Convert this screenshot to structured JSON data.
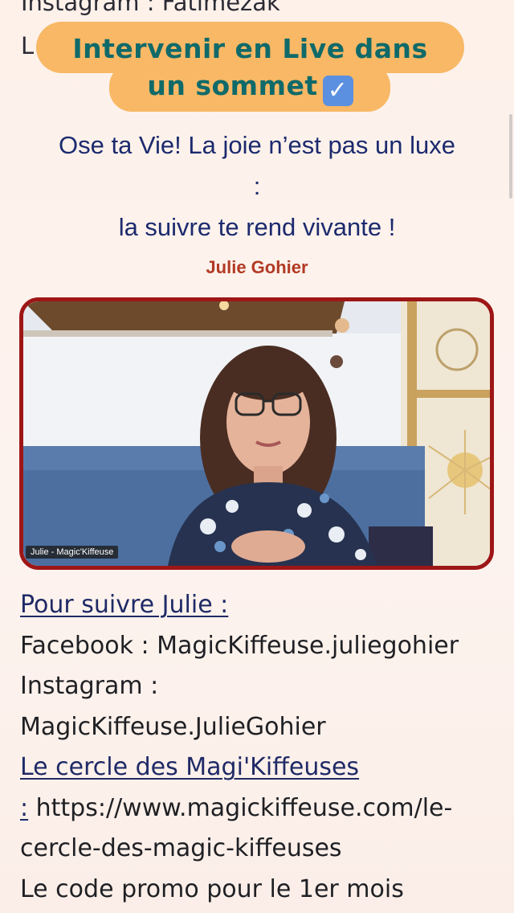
{
  "prev_section": {
    "instagram_line": "Instagram : Fatimezak",
    "cut_letter": "L"
  },
  "banner": {
    "line1": "Intervenir en Live dans",
    "line2": "un sommet",
    "check_icon": "check-mark-button-icon"
  },
  "talk": {
    "title_line1": "Ose ta Vie! La joie n’est pas un luxe",
    "title_line2": ":",
    "title_line3": "la suivre te rend vivante !",
    "speaker": "Julie Gohier"
  },
  "video": {
    "participant_name": "Julie - Magic'Kiffeuse"
  },
  "follow": {
    "heading": "Pour suivre Julie :",
    "facebook": "Facebook : MagicKiffeuse.juliegohier",
    "instagram_label": "Instagram :",
    "instagram_handle": "MagicKiffeuse.JulieGohier",
    "circle_link": "Le cercle des Magi'Kiffeuses",
    "circle_colon": ":",
    "circle_url_part1": " https://www.magickiffeuse.com/le-",
    "circle_url_part2": "cercle-des-magic-kiffeuses",
    "promo": "Le code promo pour le 1er mois"
  },
  "colors": {
    "banner": "#f8b865",
    "banner_text": "#0f6a69",
    "title": "#1c2a6e",
    "speaker": "#b23a24",
    "frame": "#9e1616"
  }
}
